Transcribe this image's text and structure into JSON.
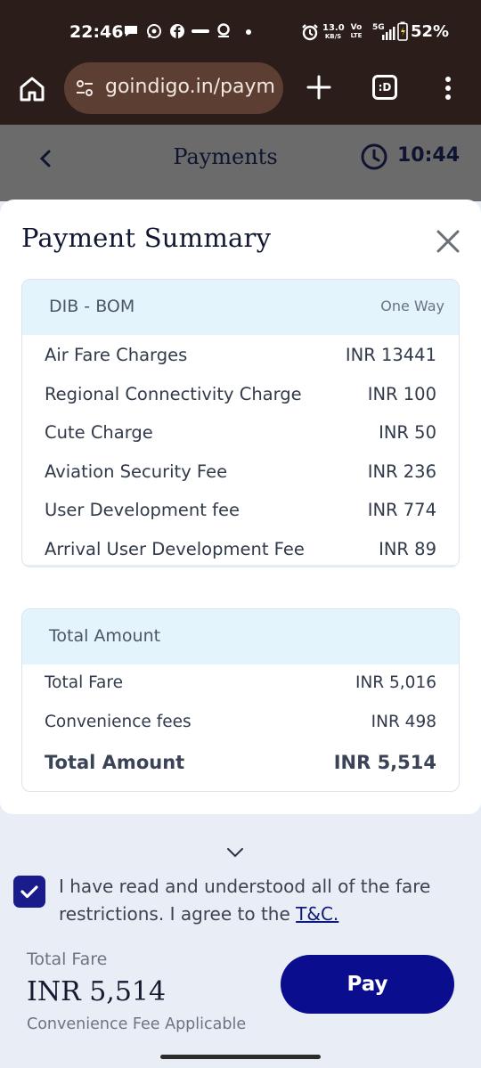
{
  "status_bar": {
    "time": "22:46",
    "net_speed_top": "13.0",
    "net_speed_bottom": "KB/S",
    "volte_top": "Vo",
    "volte_bottom": "LTE",
    "network": "5G",
    "battery": "52%",
    "icons": [
      "chat-icon",
      "whatsapp-icon",
      "facebook-icon",
      "zomato-icon",
      "swiggy-icon",
      "dot-icon",
      "alarm-icon",
      "signal-icon",
      "battery-icon"
    ]
  },
  "browser": {
    "url": "goindigo.in/paym",
    "tabs_label": ":D"
  },
  "page_header": {
    "title": "Payments",
    "timer": "10:44"
  },
  "summary": {
    "title": "Payment Summary",
    "route": "DIB - BOM",
    "trip_type": "One Way",
    "charges": [
      {
        "label": "Air Fare Charges",
        "value": "INR 13441"
      },
      {
        "label": "Regional Connectivity Charge",
        "value": "INR 100"
      },
      {
        "label": "Cute Charge",
        "value": "INR 50"
      },
      {
        "label": "Aviation Security Fee",
        "value": "INR 236"
      },
      {
        "label": "User Development fee",
        "value": "INR 774"
      },
      {
        "label": "Arrival User Development Fee",
        "value": "INR 89"
      }
    ],
    "total_header": "Total Amount",
    "total_fare_label": "Total Fare",
    "total_fare_value": "INR 5,016",
    "convenience_label": "Convenience fees",
    "convenience_value": "INR 498",
    "total_label": "Total Amount",
    "total_value": "INR 5,514"
  },
  "footer": {
    "agree_text": "I have read and understood all of the fare restrictions. I agree to the ",
    "tc_link": "T&C.",
    "total_fare_label": "Total Fare",
    "total_fare_amount": "INR 5,514",
    "convenience_note": "Convenience Fee Applicable",
    "pay_label": "Pay"
  },
  "colors": {
    "brand_navy": "#0b0d8f",
    "header_blue": "#e4f4fd",
    "status_bar": "#2a1d1a",
    "url_pill": "#5c3e33"
  }
}
